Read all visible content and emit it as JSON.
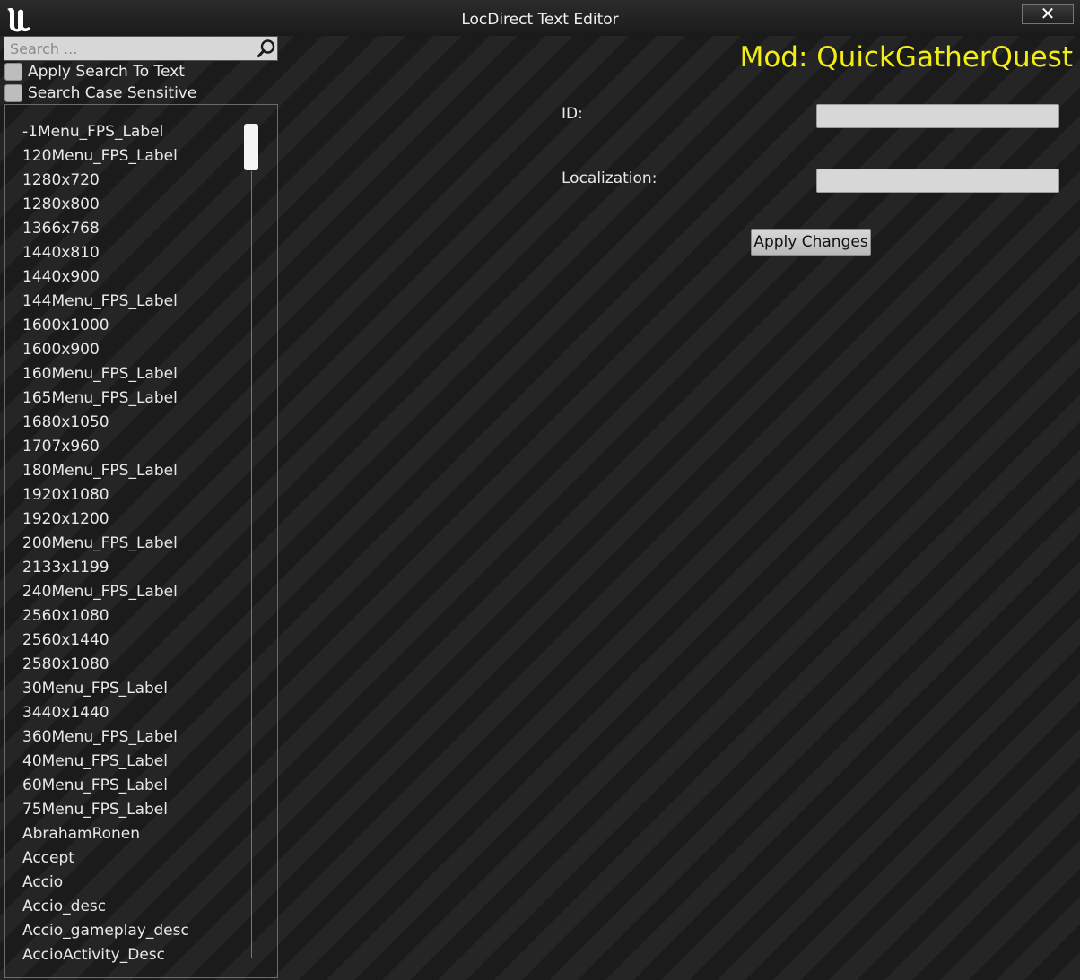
{
  "window": {
    "title": "LocDirect Text Editor",
    "close_icon": "close-icon",
    "close_glyph": "✕"
  },
  "search": {
    "placeholder": "Search ...",
    "value": "",
    "icon": "search-icon"
  },
  "options": {
    "apply_search_to_text": {
      "label": "Apply Search To Text",
      "checked": false
    },
    "search_case_sensitive": {
      "label": "Search Case Sensitive",
      "checked": false
    }
  },
  "list": {
    "items": [
      "-1Menu_FPS_Label",
      "120Menu_FPS_Label",
      "1280x720",
      "1280x800",
      "1366x768",
      "1440x810",
      "1440x900",
      "144Menu_FPS_Label",
      "1600x1000",
      "1600x900",
      "160Menu_FPS_Label",
      "165Menu_FPS_Label",
      "1680x1050",
      "1707x960",
      "180Menu_FPS_Label",
      "1920x1080",
      "1920x1200",
      "200Menu_FPS_Label",
      "2133x1199",
      "240Menu_FPS_Label",
      "2560x1080",
      "2560x1440",
      "2580x1080",
      "30Menu_FPS_Label",
      "3440x1440",
      "360Menu_FPS_Label",
      "40Menu_FPS_Label",
      "60Menu_FPS_Label",
      "75Menu_FPS_Label",
      "AbrahamRonen",
      "Accept",
      "Accio",
      "Accio_desc",
      "Accio_gameplay_desc",
      "AccioActivity_Desc"
    ]
  },
  "mod": {
    "label": "Mod: QuickGatherQuest",
    "color": "#f2ee12"
  },
  "fields": {
    "id_label": "ID:",
    "id_value": "",
    "localization_label": "Localization:",
    "localization_value": ""
  },
  "apply_button": {
    "label": "Apply Changes"
  }
}
